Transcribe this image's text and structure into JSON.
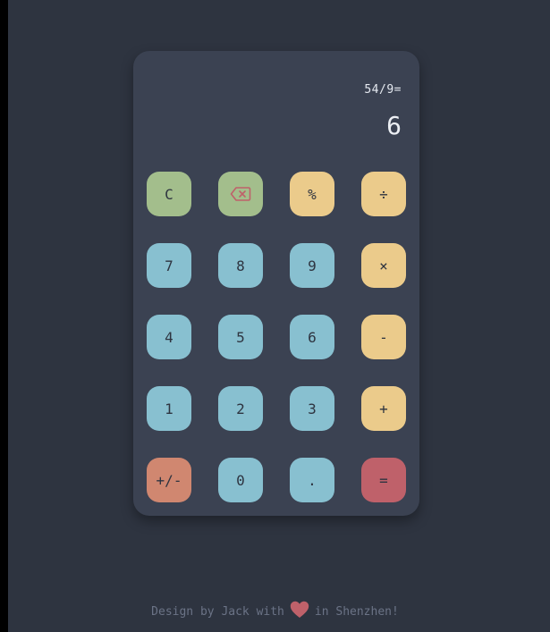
{
  "display": {
    "expression": "54/9=",
    "result": "6"
  },
  "keys": {
    "clear": "C",
    "backspace_icon": "backspace-icon",
    "percent": "%",
    "divide": "÷",
    "seven": "7",
    "eight": "8",
    "nine": "9",
    "multiply": "×",
    "four": "4",
    "five": "5",
    "six": "6",
    "minus": "-",
    "one": "1",
    "two": "2",
    "three": "3",
    "plus": "+",
    "negate": "+/-",
    "zero": "0",
    "decimal": ".",
    "equals": "="
  },
  "footer": {
    "prefix": "Design by Jack with",
    "heart_icon": "heart-icon",
    "suffix": "in Shenzhen!"
  },
  "colors": {
    "background": "#2e3440",
    "panel": "#3b4252",
    "function_key": "#a3be8c",
    "number_key": "#88c0d0",
    "operator_key": "#ebcb8b",
    "negate_key": "#d08770",
    "equals_key": "#bf616a",
    "heart": "#bf616a"
  }
}
